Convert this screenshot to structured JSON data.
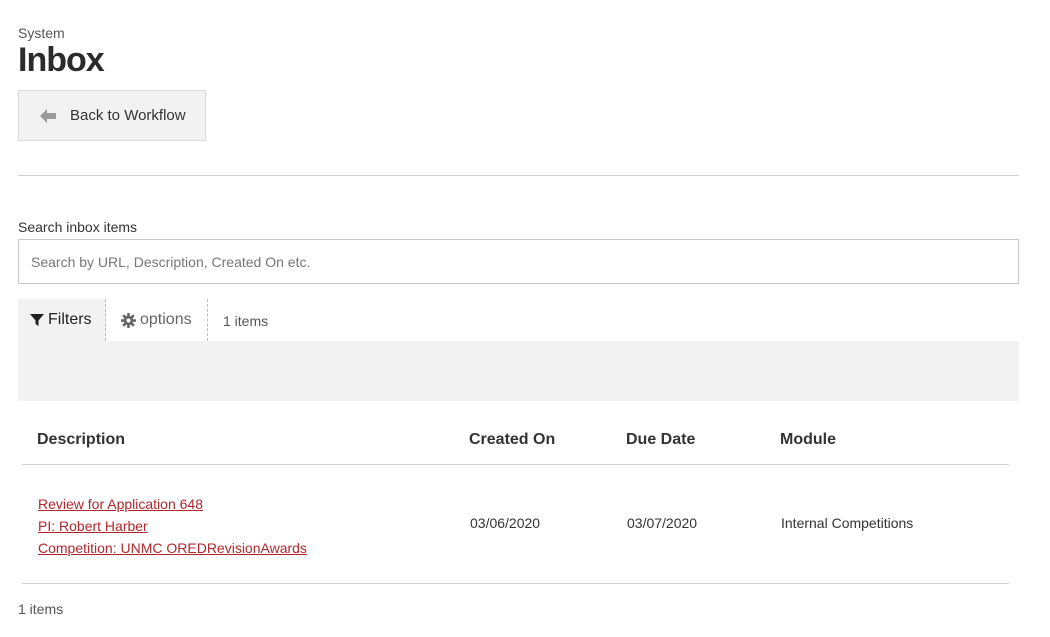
{
  "header": {
    "breadcrumb": "System",
    "title": "Inbox",
    "back_label": "Back to Workflow"
  },
  "search": {
    "label": "Search inbox items",
    "placeholder": "Search by URL, Description, Created On etc.",
    "value": ""
  },
  "toolbar": {
    "filters_label": "Filters",
    "options_label": "options",
    "items_count": "1 items"
  },
  "table": {
    "columns": [
      "Description",
      "Created On",
      "Due Date",
      "Module"
    ],
    "rows": [
      {
        "description": [
          "Review for Application 648",
          "PI: Robert Harber",
          "Competition: UNMC OREDRevisionAwards"
        ],
        "created_on": "03/06/2020",
        "due_date": "03/07/2020",
        "module": "Internal Competitions"
      }
    ]
  },
  "footer": {
    "items_count": "1 items"
  },
  "colors": {
    "link": "#b0272d",
    "panel_bg": "#f2f2f2"
  },
  "icons": {
    "back": "arrow-left-icon",
    "filters": "funnel-icon",
    "options": "gear-icon"
  }
}
